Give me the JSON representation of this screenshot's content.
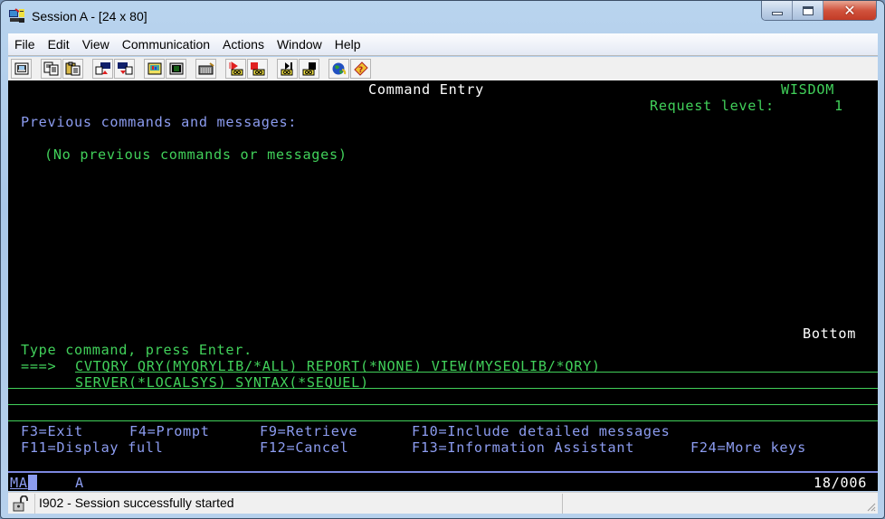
{
  "window": {
    "title": "Session A - [24 x 80]",
    "controls": {
      "minimize": "minimize",
      "maximize": "maximize",
      "close": "✕"
    }
  },
  "menu": [
    "File",
    "Edit",
    "View",
    "Communication",
    "Actions",
    "Window",
    "Help"
  ],
  "toolbar": [
    {
      "icon": "print-screen-icon"
    },
    {
      "icon": "copy-icon"
    },
    {
      "icon": "paste-icon"
    },
    {
      "icon": "send-icon"
    },
    {
      "icon": "receive-icon"
    },
    {
      "icon": "display-setup-icon"
    },
    {
      "icon": "color-map-icon"
    },
    {
      "icon": "keyboard-map-icon"
    },
    {
      "icon": "record-macro-icon"
    },
    {
      "icon": "stop-macro-icon"
    },
    {
      "icon": "play-macro-icon"
    },
    {
      "icon": "pause-macro-icon"
    },
    {
      "icon": "globe-icon"
    },
    {
      "icon": "help-icon"
    }
  ],
  "terminal": {
    "screen_title": "Command Entry",
    "system_name": "WISDOM",
    "request_level_label": "Request level:",
    "request_level_value": "1",
    "previous_heading": "Previous commands and messages:",
    "no_previous": "(No previous commands or messages)",
    "scroll_indicator": "Bottom",
    "prompt_instruction": "Type command, press Enter.",
    "prompt_arrow": "===>",
    "command_line_1": "CVTQRY QRY(MYQRYLIB/*ALL) REPORT(*NONE) VIEW(MYSEQLIB/*QRY)",
    "command_line_2": "SERVER(*LOCALSYS) SYNTAX(*SEQUEL)",
    "function_keys": {
      "row1": [
        "F3=Exit",
        "F4=Prompt",
        "F9=Retrieve",
        "F10=Include detailed messages"
      ],
      "row2": [
        "F11=Display full",
        "F12=Cancel",
        "F13=Information Assistant",
        "F24=More keys"
      ]
    },
    "oia": {
      "indicator": "MA",
      "mode": "A",
      "cursor_position": "18/006"
    }
  },
  "statusbar": {
    "message": "I902 - Session successfully started"
  },
  "colors": {
    "terminal_bg": "#000000",
    "green": "#41d05a",
    "blue": "#8c9cf0",
    "white": "#ffffff"
  }
}
